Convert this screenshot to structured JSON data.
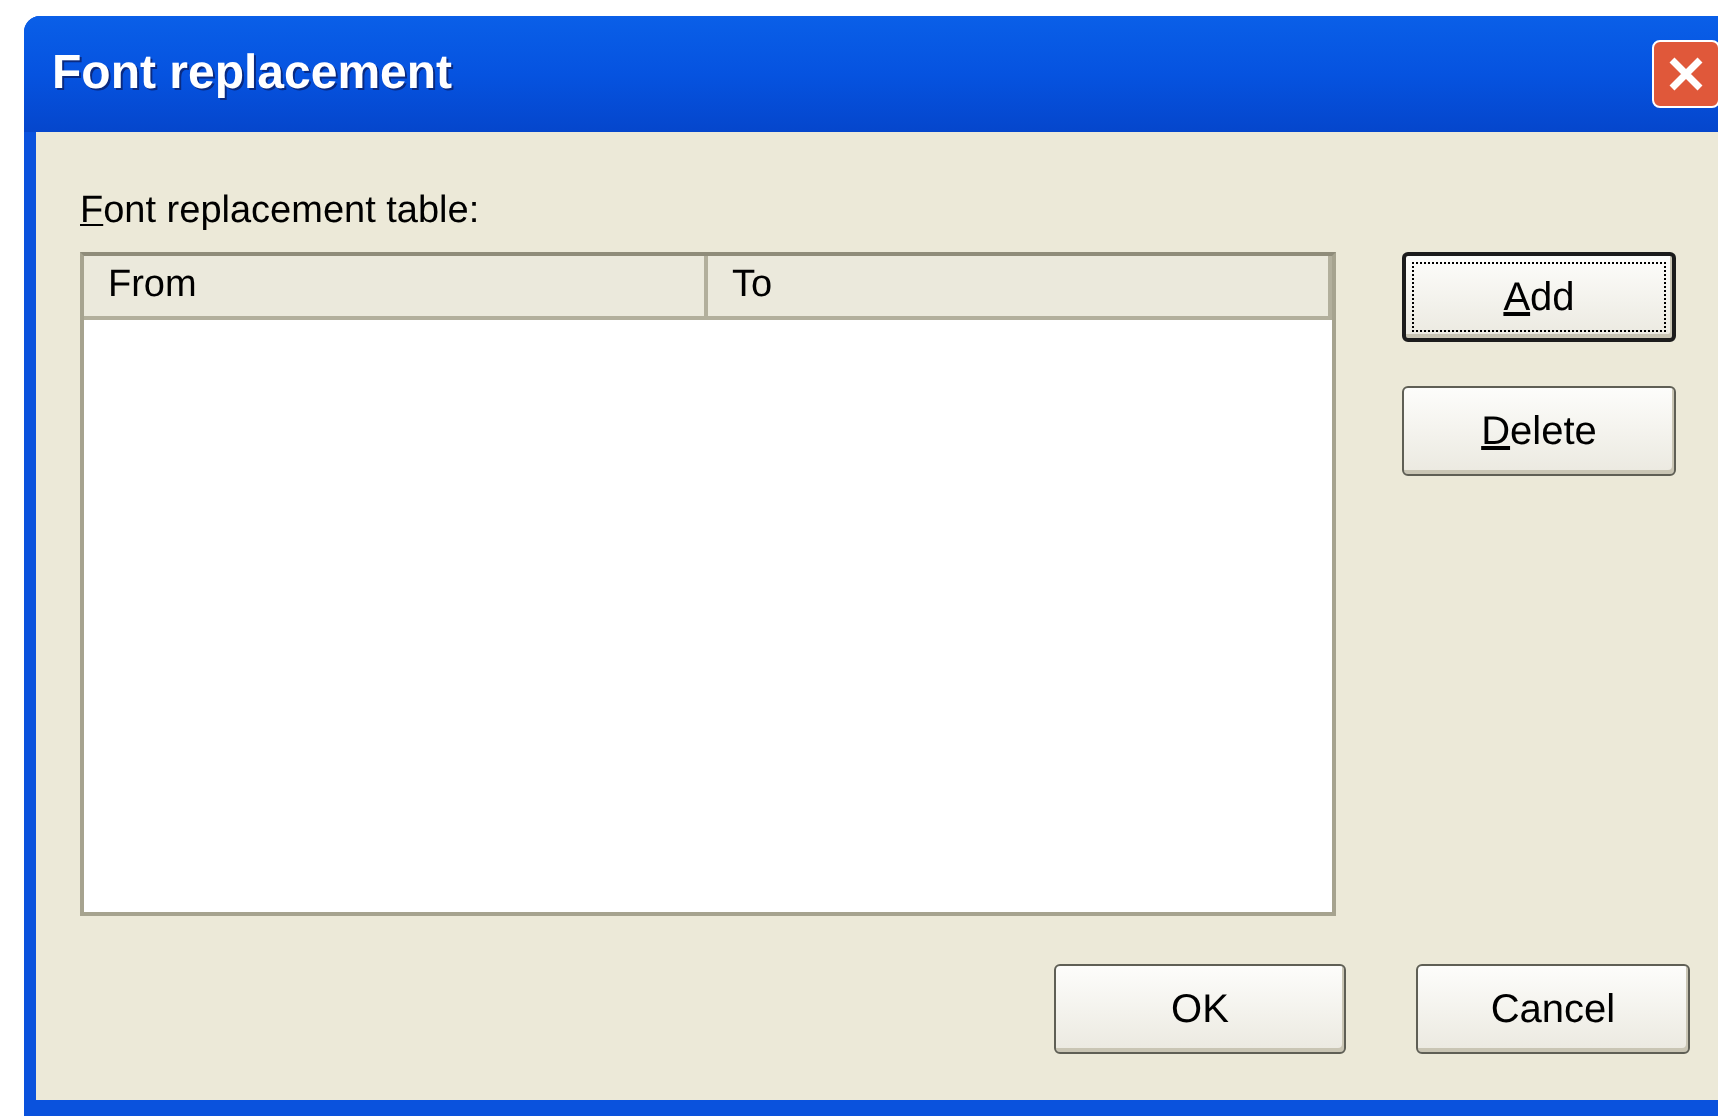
{
  "window": {
    "title": "Font replacement"
  },
  "table_label": {
    "text": "Font replacement table:",
    "underline_first": true
  },
  "table": {
    "columns": [
      "From",
      "To"
    ]
  },
  "side_buttons": [
    {
      "label": "Add",
      "underline_first": true,
      "focused": true
    },
    {
      "label": "Delete",
      "underline_first": true,
      "focused": false
    }
  ],
  "footer_buttons": [
    {
      "label": "OK",
      "underline_first": false,
      "focused": false
    },
    {
      "label": "Cancel",
      "underline_first": false,
      "focused": false
    }
  ]
}
